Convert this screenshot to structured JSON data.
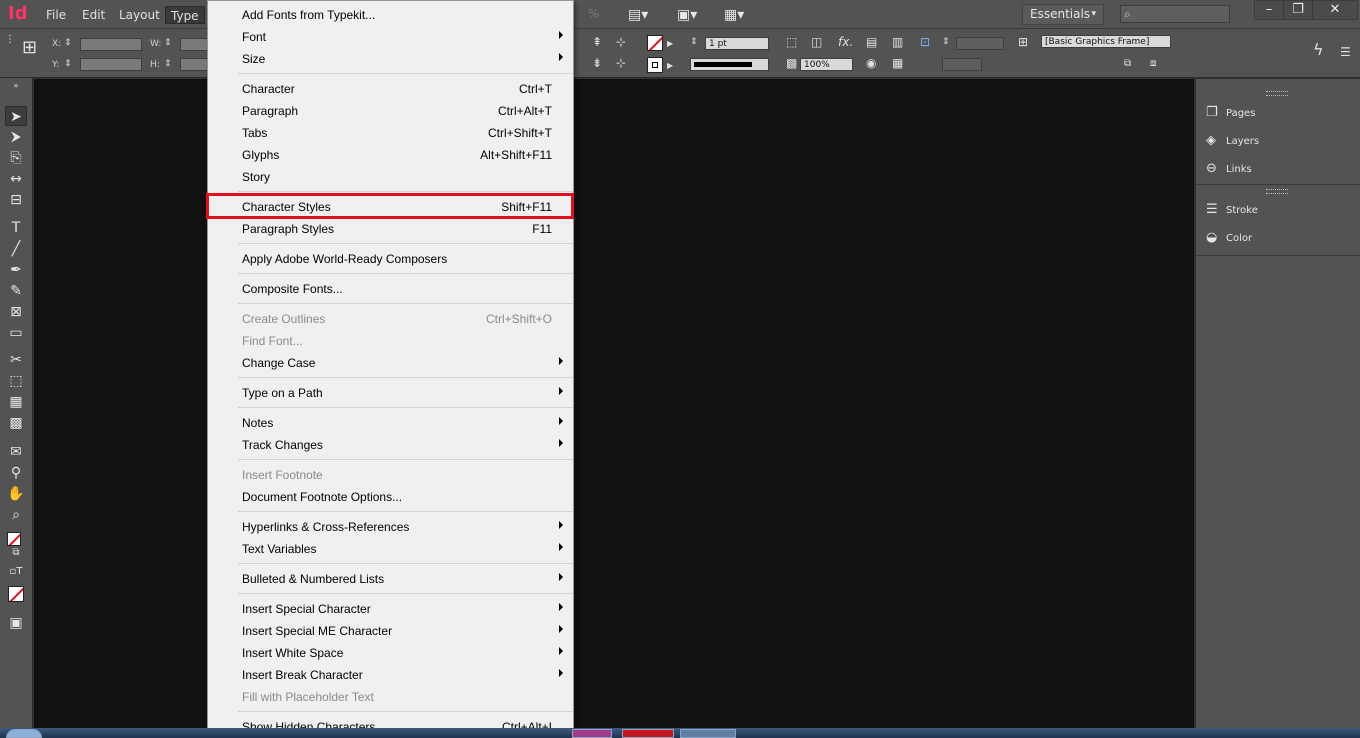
{
  "app": {
    "logo_text": "Id",
    "brand_color": "#ff3366"
  },
  "menubar": {
    "items": [
      "File",
      "Edit",
      "Layout",
      "Type"
    ],
    "active_item": "Type",
    "zoom_fragment": "%",
    "workspace": "Essentials",
    "search_icon": "⌕"
  },
  "window_controls": {
    "minimize": "–",
    "restore": "❐",
    "close": "✕"
  },
  "controlbar": {
    "x_label": "X:",
    "y_label": "Y:",
    "w_label": "W:",
    "h_label": "H:",
    "stroke_weight": "1 pt",
    "opacity": "100%",
    "object_style": "[Basic Graphics Frame]"
  },
  "panels": {
    "group1": [
      "Pages",
      "Layers",
      "Links"
    ],
    "group2": [
      "Stroke",
      "Color"
    ]
  },
  "type_menu": {
    "items": [
      {
        "label": "Add Fonts from Typekit...",
        "shortcut": "",
        "submenu": false,
        "disabled": false
      },
      {
        "label": "Font",
        "shortcut": "",
        "submenu": true,
        "disabled": false
      },
      {
        "label": "Size",
        "shortcut": "",
        "submenu": true,
        "disabled": false
      },
      {
        "label": "Character",
        "shortcut": "Ctrl+T",
        "submenu": false,
        "disabled": false
      },
      {
        "label": "Paragraph",
        "shortcut": "Ctrl+Alt+T",
        "submenu": false,
        "disabled": false
      },
      {
        "label": "Tabs",
        "shortcut": "Ctrl+Shift+T",
        "submenu": false,
        "disabled": false
      },
      {
        "label": "Glyphs",
        "shortcut": "Alt+Shift+F11",
        "submenu": false,
        "disabled": false
      },
      {
        "label": "Story",
        "shortcut": "",
        "submenu": false,
        "disabled": false
      },
      {
        "label": "Character Styles",
        "shortcut": "Shift+F11",
        "submenu": false,
        "disabled": false
      },
      {
        "label": "Paragraph Styles",
        "shortcut": "F11",
        "submenu": false,
        "disabled": false
      },
      {
        "label": "Apply Adobe World-Ready Composers",
        "shortcut": "",
        "submenu": false,
        "disabled": false
      },
      {
        "label": "Composite Fonts...",
        "shortcut": "",
        "submenu": false,
        "disabled": false
      },
      {
        "label": "Create Outlines",
        "shortcut": "Ctrl+Shift+O",
        "submenu": false,
        "disabled": true
      },
      {
        "label": "Find Font...",
        "shortcut": "",
        "submenu": false,
        "disabled": true
      },
      {
        "label": "Change Case",
        "shortcut": "",
        "submenu": true,
        "disabled": false
      },
      {
        "label": "Type on a Path",
        "shortcut": "",
        "submenu": true,
        "disabled": false
      },
      {
        "label": "Notes",
        "shortcut": "",
        "submenu": true,
        "disabled": false
      },
      {
        "label": "Track Changes",
        "shortcut": "",
        "submenu": true,
        "disabled": false
      },
      {
        "label": "Insert Footnote",
        "shortcut": "",
        "submenu": false,
        "disabled": true
      },
      {
        "label": "Document Footnote Options...",
        "shortcut": "",
        "submenu": false,
        "disabled": false
      },
      {
        "label": "Hyperlinks & Cross-References",
        "shortcut": "",
        "submenu": true,
        "disabled": false
      },
      {
        "label": "Text Variables",
        "shortcut": "",
        "submenu": true,
        "disabled": false
      },
      {
        "label": "Bulleted & Numbered Lists",
        "shortcut": "",
        "submenu": true,
        "disabled": false
      },
      {
        "label": "Insert Special Character",
        "shortcut": "",
        "submenu": true,
        "disabled": false
      },
      {
        "label": "Insert Special ME Character",
        "shortcut": "",
        "submenu": true,
        "disabled": false
      },
      {
        "label": "Insert White Space",
        "shortcut": "",
        "submenu": true,
        "disabled": false
      },
      {
        "label": "Insert Break Character",
        "shortcut": "",
        "submenu": true,
        "disabled": false
      },
      {
        "label": "Fill with Placeholder Text",
        "shortcut": "",
        "submenu": false,
        "disabled": true
      },
      {
        "label": "Show Hidden Characters",
        "shortcut": "Ctrl+Alt+I",
        "submenu": false,
        "disabled": false
      }
    ],
    "highlighted": "Character Styles",
    "highlight_color": "#e0101f"
  }
}
